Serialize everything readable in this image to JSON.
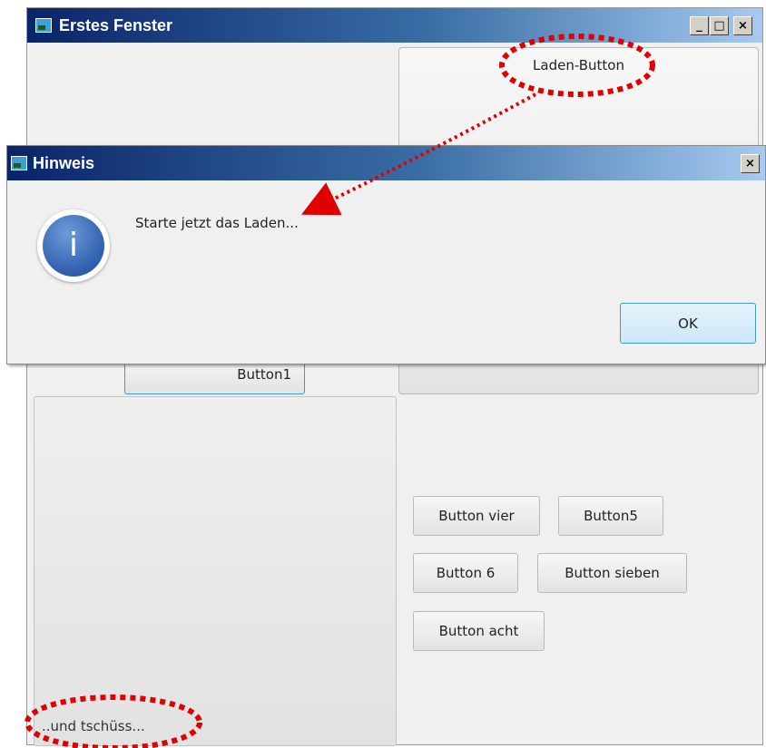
{
  "main_window": {
    "title": "Erstes Fenster",
    "controls": {
      "minimize": "_",
      "maximize": "□",
      "close": "×"
    },
    "buttons": {
      "laden": "Laden-Button",
      "button1": "Button1",
      "button_vier": "Button vier",
      "button5": "Button5",
      "button6": "Button 6",
      "button_sieben": "Button sieben",
      "button_acht": "Button acht"
    },
    "footer_label": "..und tschüss..."
  },
  "dialog": {
    "title": "Hinweis",
    "close": "×",
    "icon": "info-icon",
    "message": "Starte jetzt das Laden...",
    "ok_label": "OK"
  },
  "colors": {
    "titlebar_start": "#0a246a",
    "titlebar_end": "#a6caf0",
    "annotation": "#e00000",
    "ok_border": "#3c9ad6"
  }
}
